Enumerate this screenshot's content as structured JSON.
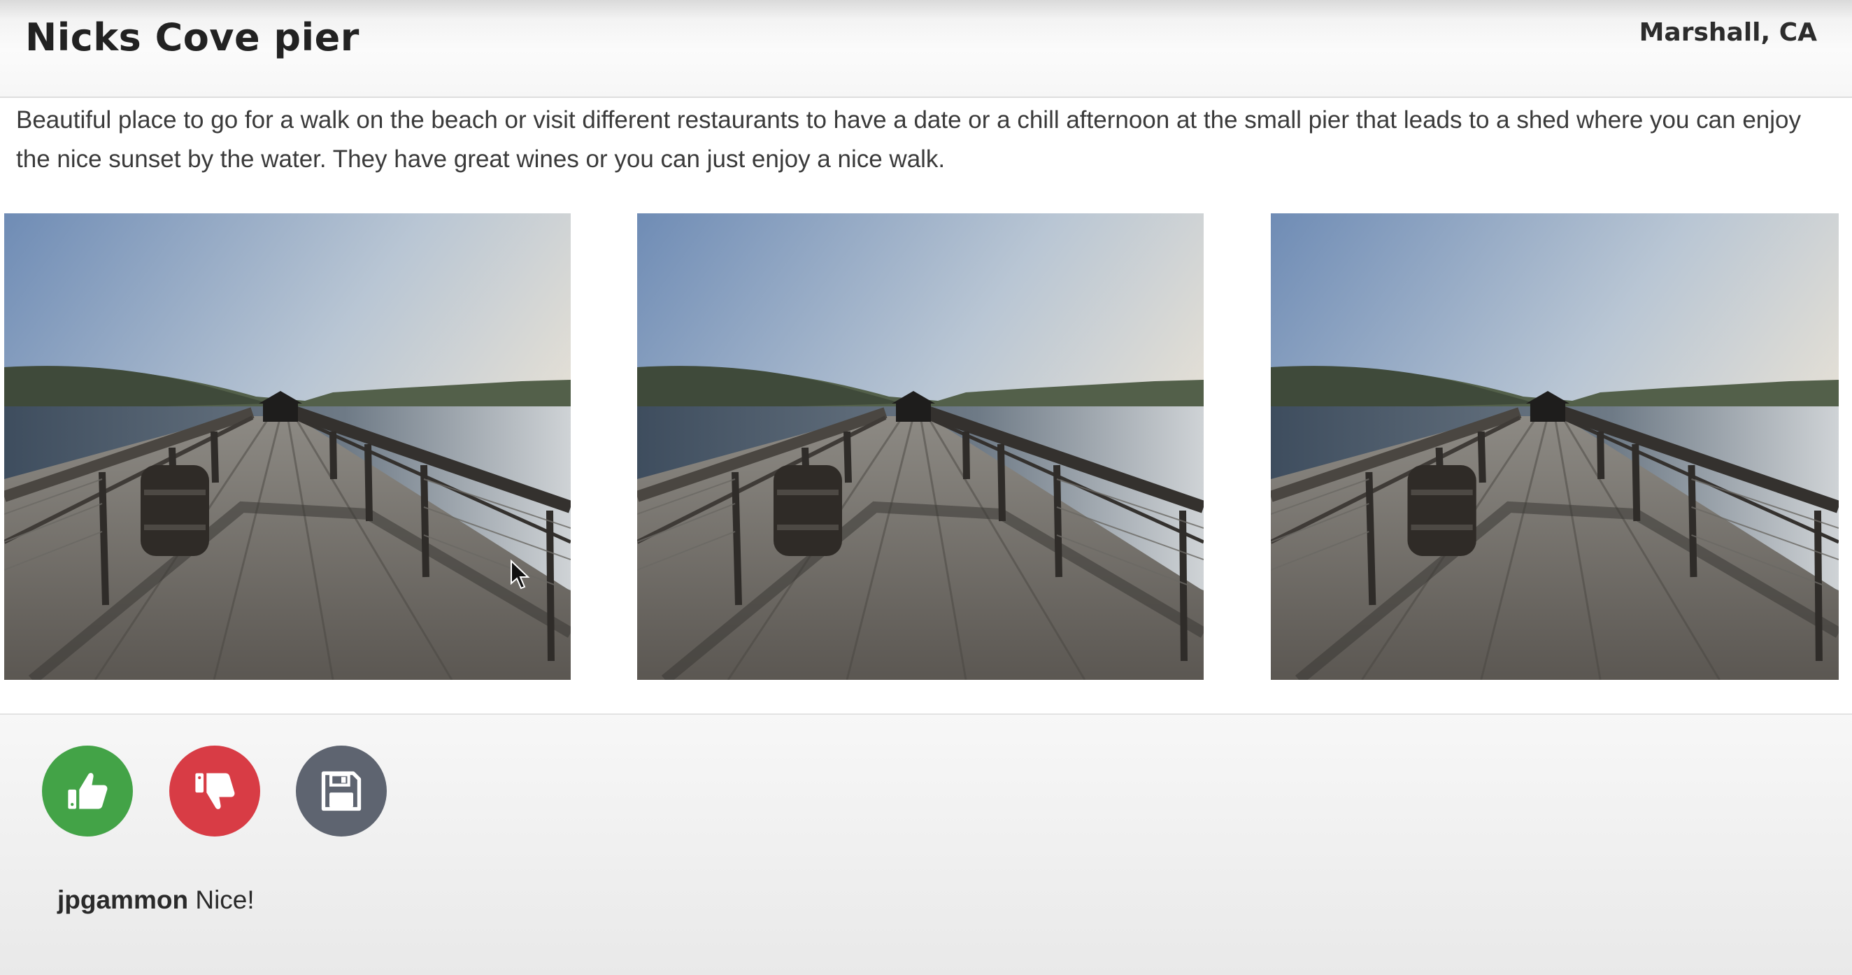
{
  "header": {
    "title": "Nicks Cove pier",
    "location": "Marshall, CA"
  },
  "post": {
    "description": "Beautiful place to go for a walk on the beach or visit different restaurants to have a date or a chill afternoon at the small pier that leads to a shed where you can enjoy the nice sunset by the water. They have great wines or you can just enjoy a nice walk."
  },
  "photos": [
    {
      "subject": "wooden pier with railings and barrel leading to a shed over the bay"
    },
    {
      "subject": "wooden pier with railings and barrel leading to a shed over the bay"
    },
    {
      "subject": "wooden pier with railings and barrel leading to a shed over the bay"
    }
  ],
  "actions": {
    "like_icon": "thumbs-up-icon",
    "dislike_icon": "thumbs-down-icon",
    "save_icon": "floppy-disk-icon",
    "like_color": "#43a347",
    "dislike_color": "#d83c45",
    "save_color": "#5e6470"
  },
  "comments": [
    {
      "user": "jpgammon",
      "text": "Nice!"
    }
  ]
}
